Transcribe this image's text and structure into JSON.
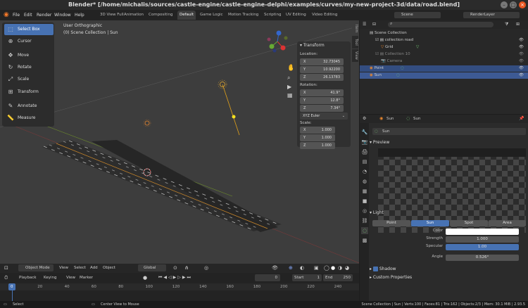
{
  "window": {
    "title": "Blender* [/home/michalis/sources/castle-engine/castle-engine-delphi/examples/curves/my-new-project-3d/data/road.blend]"
  },
  "menu": {
    "file": "File",
    "edit": "Edit",
    "render": "Render",
    "window": "Window",
    "help": "Help"
  },
  "workspaces": [
    "3D View Full",
    "Animation",
    "Compositing",
    "Default",
    "Game Logic",
    "Motion Tracking",
    "Scripting",
    "UV Editing",
    "Video Editing"
  ],
  "active_workspace": "Default",
  "scene": {
    "label": "Scene",
    "render_layer": "RenderLayer"
  },
  "viewport": {
    "view_name": "User Orthographic",
    "collection_info": "(0) Scene Collection | Sun",
    "tools": [
      "Select Box",
      "Cursor",
      "Move",
      "Rotate",
      "Scale",
      "Transform",
      "Annotate",
      "Measure"
    ],
    "gizmo": {
      "x": "X",
      "y": "Y",
      "z": "Z"
    }
  },
  "npanel": {
    "header": "Transform",
    "location_label": "Location:",
    "location": {
      "x": "32.73045",
      "y": "10.92200",
      "z": "26.13783"
    },
    "rotation_label": "Rotation:",
    "rotation": {
      "x": "41.9°",
      "y": "12.8°",
      "z": "7.34°"
    },
    "rotation_mode": "XYZ Euler",
    "scale_label": "Scale:",
    "scale": {
      "x": "1.000",
      "y": "1.000",
      "z": "1.000"
    },
    "axis": {
      "x": "X",
      "y": "Y",
      "z": "Z"
    },
    "tabs": [
      "Item",
      "Tool",
      "View"
    ]
  },
  "viewport_header": {
    "mode": "Object Mode",
    "view": "View",
    "select": "Select",
    "add": "Add",
    "object": "Object",
    "orientation": "Global"
  },
  "timeline": {
    "playback": "Playback",
    "keying": "Keying",
    "view": "View",
    "marker": "Marker",
    "current_frame": "0",
    "start_label": "Start",
    "start": "1",
    "end_label": "End",
    "end": "250",
    "ruler": [
      "0",
      "20",
      "40",
      "60",
      "80",
      "100",
      "120",
      "140",
      "160",
      "180",
      "200",
      "220",
      "240"
    ]
  },
  "statusbar": {
    "select": "Select",
    "center": "Center View to Mouse",
    "stats": "Scene Collection | Sun | Verts:100 | Faces:81 | Tris:162 | Objects:2/3 | Mem: 30.1 MiB | 2.93.5"
  },
  "outliner": {
    "root": "Scene Collection",
    "items": [
      {
        "name": "collection road",
        "indent": 1,
        "selected": false
      },
      {
        "name": "Grid",
        "indent": 2,
        "selected": false
      },
      {
        "name": "Collection 10",
        "indent": 1,
        "selected": false
      },
      {
        "name": "Camera",
        "indent": 2,
        "selected": false
      },
      {
        "name": "Point",
        "indent": 1,
        "selected": true
      },
      {
        "name": "Sun",
        "indent": 1,
        "selected": true
      }
    ]
  },
  "properties": {
    "breadcrumb_object": "Sun",
    "breadcrumb_data": "Sun",
    "data_name": "Sun",
    "preview_label": "Preview",
    "light_label": "Light",
    "light_types": [
      "Point",
      "Sun",
      "Spot",
      "Area"
    ],
    "active_light_type": "Sun",
    "color_label": "Color",
    "color_value": "#ffffff",
    "strength_label": "Strength",
    "strength": "1.000",
    "specular_label": "Specular",
    "specular": "1.00",
    "angle_label": "Angle",
    "angle": "0.526°",
    "shadow_label": "Shadow",
    "custom_props_label": "Custom Properties"
  },
  "colors": {
    "accent": "#4772b3",
    "selected_row": "#334d80",
    "road": "#2a2a2a",
    "sun_ray": "#e3a21a"
  }
}
